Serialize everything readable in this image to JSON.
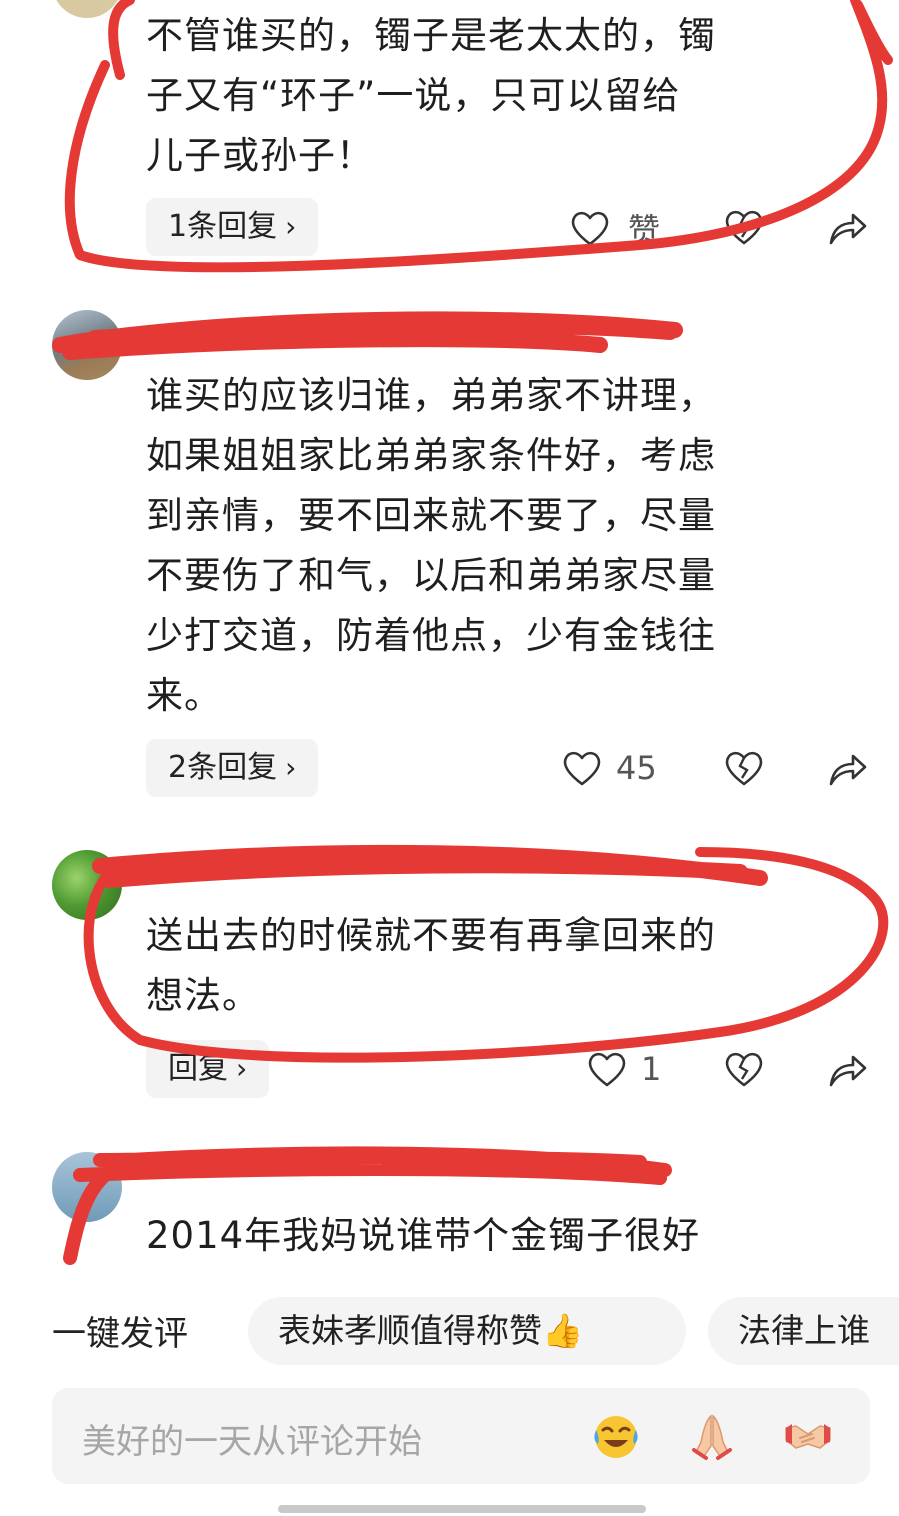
{
  "comments": [
    {
      "text": "不管谁买的，镯子是老太太的，镯\n子又有“环子”一说，只可以留给\n儿子或孙子！",
      "reply_label": "1条回复",
      "like_text": "赞"
    },
    {
      "text": "谁买的应该归谁，弟弟家不讲理，\n如果姐姐家比弟弟家条件好，考虑\n到亲情，要不回来就不要了，尽量\n不要伤了和气，以后和弟弟家尽量\n少打交道，防着他点，少有金钱往\n来。",
      "reply_label": "2条回复",
      "like_text": "45"
    },
    {
      "text": "送出去的时候就不要有再拿回来的\n想法。",
      "reply_label": "回复",
      "like_text": "1"
    },
    {
      "text": "2014年我妈说谁带个金镯子很好"
    }
  ],
  "quick_comment": {
    "label": "一键发评",
    "chips": [
      "表妹孝顺值得称赞👍",
      "法律上谁"
    ]
  },
  "input": {
    "placeholder": "美好的一天从评论开始",
    "emojis": [
      "laughing-crying-emoji",
      "praying-hands-emoji",
      "handshake-emoji"
    ]
  },
  "colors": {
    "annotation_red": "#e53935",
    "chip_bg": "#f4f4f4",
    "text": "#1f1f1f",
    "placeholder": "#a6a6a6"
  }
}
